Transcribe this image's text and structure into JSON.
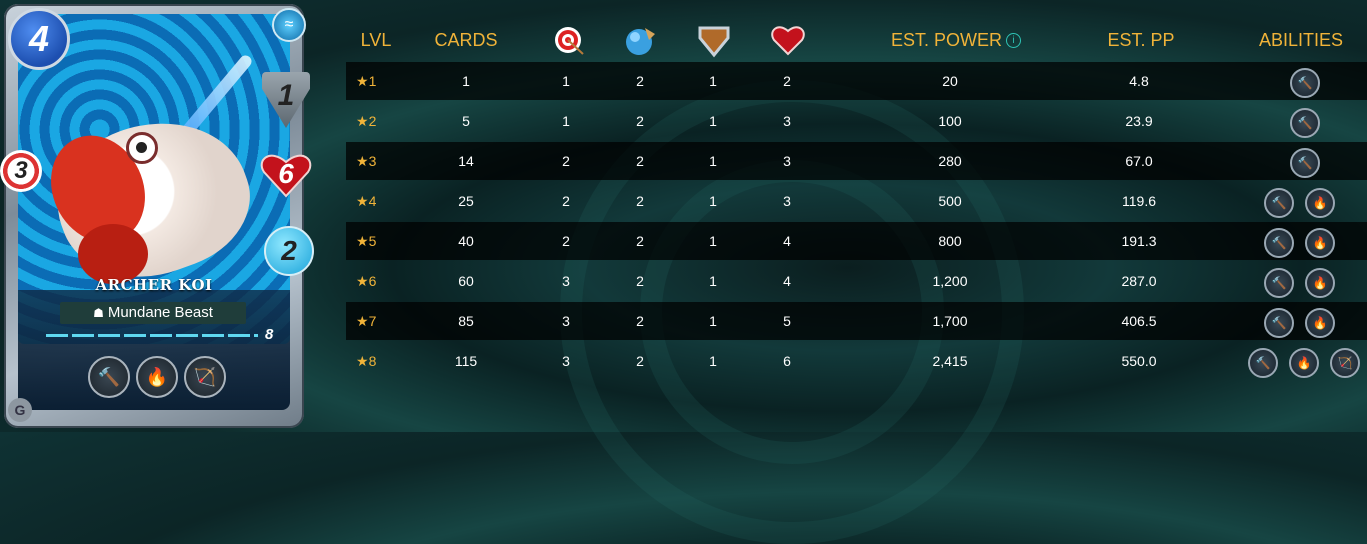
{
  "card": {
    "name": "ARCHER KOI",
    "type": "Mundane Beast",
    "mana": "4",
    "armor": "1",
    "health": "6",
    "speed": "2",
    "ranged": "3",
    "level": "8",
    "abilities": [
      "hammer-icon",
      "enrage-icon",
      "reach-icon"
    ]
  },
  "table": {
    "headers": {
      "lvl": "LVL",
      "cards": "CARDS",
      "ranged_icon": "ranged-attack-icon",
      "speed_icon": "speed-icon",
      "armor_icon": "armor-icon",
      "health_icon": "health-icon",
      "est_power": "EST. POWER",
      "est_pp": "EST. PP",
      "abilities": "ABILITIES"
    },
    "rows": [
      {
        "lvl": "1",
        "cards": "1",
        "ranged": "1",
        "speed": "2",
        "armor": "1",
        "health": "2",
        "power": "20",
        "pp": "4.8",
        "abilities": [
          "hammer-icon"
        ]
      },
      {
        "lvl": "2",
        "cards": "5",
        "ranged": "1",
        "speed": "2",
        "armor": "1",
        "health": "3",
        "power": "100",
        "pp": "23.9",
        "abilities": [
          "hammer-icon"
        ]
      },
      {
        "lvl": "3",
        "cards": "14",
        "ranged": "2",
        "speed": "2",
        "armor": "1",
        "health": "3",
        "power": "280",
        "pp": "67.0",
        "abilities": [
          "hammer-icon"
        ]
      },
      {
        "lvl": "4",
        "cards": "25",
        "ranged": "2",
        "speed": "2",
        "armor": "1",
        "health": "3",
        "power": "500",
        "pp": "119.6",
        "abilities": [
          "hammer-icon",
          "enrage-icon"
        ]
      },
      {
        "lvl": "5",
        "cards": "40",
        "ranged": "2",
        "speed": "2",
        "armor": "1",
        "health": "4",
        "power": "800",
        "pp": "191.3",
        "abilities": [
          "hammer-icon",
          "enrage-icon"
        ]
      },
      {
        "lvl": "6",
        "cards": "60",
        "ranged": "3",
        "speed": "2",
        "armor": "1",
        "health": "4",
        "power": "1,200",
        "pp": "287.0",
        "abilities": [
          "hammer-icon",
          "enrage-icon"
        ]
      },
      {
        "lvl": "7",
        "cards": "85",
        "ranged": "3",
        "speed": "2",
        "armor": "1",
        "health": "5",
        "power": "1,700",
        "pp": "406.5",
        "abilities": [
          "hammer-icon",
          "enrage-icon"
        ]
      },
      {
        "lvl": "8",
        "cards": "115",
        "ranged": "3",
        "speed": "2",
        "armor": "1",
        "health": "6",
        "power": "2,415",
        "pp": "550.0",
        "abilities": [
          "hammer-icon",
          "enrage-icon",
          "reach-icon"
        ]
      }
    ]
  },
  "colors": {
    "header_gold": "#f0b339",
    "row_dark": "rgba(0,0,0,0.72)",
    "info_teal": "#2ec4b6"
  }
}
